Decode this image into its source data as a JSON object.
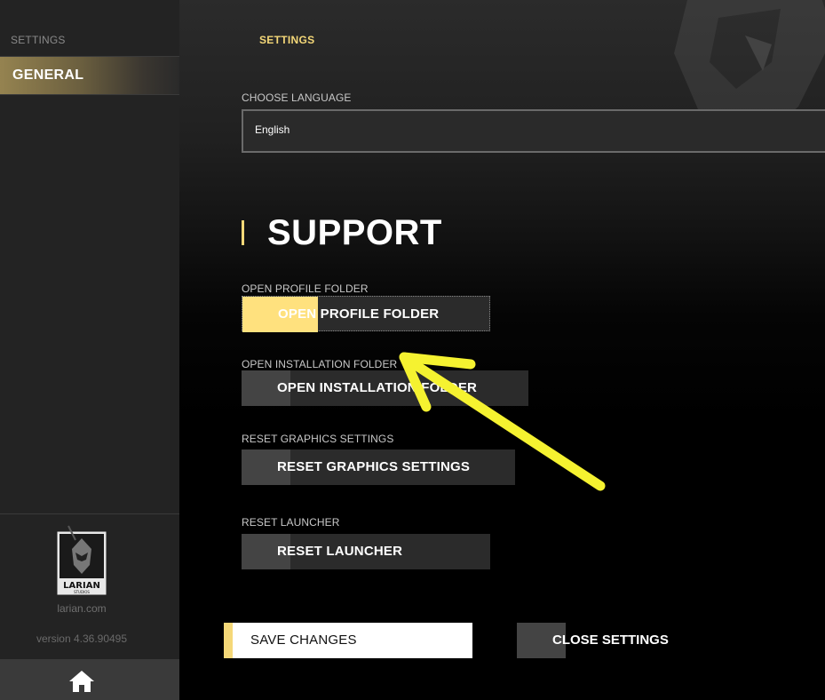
{
  "sidebar": {
    "title": "SETTINGS",
    "items": [
      {
        "label": "GENERAL",
        "active": true
      }
    ],
    "logo_text": "LARIAN",
    "logo_sub": "STUDIOS",
    "site": "larian.com",
    "version": "version 4.36.90495",
    "home_icon": "home-icon"
  },
  "main": {
    "tab_title": "SETTINGS",
    "language": {
      "label": "CHOOSE LANGUAGE",
      "value": "English"
    },
    "support": {
      "title": "SUPPORT",
      "items": [
        {
          "label": "OPEN PROFILE FOLDER",
          "button": "OPEN PROFILE FOLDER"
        },
        {
          "label": "OPEN INSTALLATION FOLDER",
          "button": "OPEN INSTALLATION FOLDER"
        },
        {
          "label": "RESET GRAPHICS SETTINGS",
          "button": "RESET GRAPHICS SETTINGS"
        },
        {
          "label": "RESET LAUNCHER",
          "button": "RESET LAUNCHER"
        }
      ]
    },
    "save_label": "SAVE CHANGES",
    "close_label": "CLOSE SETTINGS"
  },
  "colors": {
    "accent": "#f5d878",
    "sidebar_bg": "#232323",
    "button_bg": "#2b2b2b",
    "annotation_arrow": "#f5f230"
  }
}
